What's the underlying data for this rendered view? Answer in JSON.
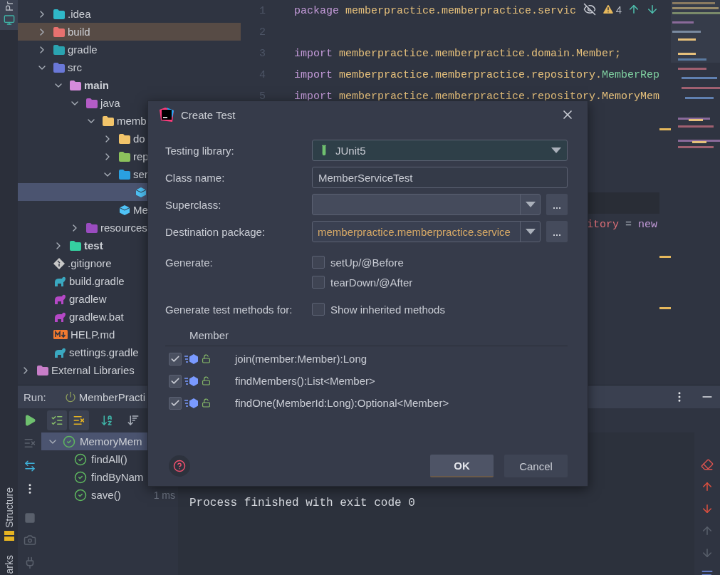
{
  "left_stripe": {
    "top_tools": [
      {
        "label": "Pr",
        "selected": true
      }
    ],
    "bottom_tools": [
      {
        "label": "Structure",
        "selected": false
      },
      {
        "label": "arks",
        "selected": false
      }
    ]
  },
  "project_tree": {
    "root_children": [
      {
        "label": ".idea",
        "kind": "idea-folder",
        "expanded": false,
        "selected": false
      },
      {
        "label": "build",
        "kind": "excluded-folder",
        "expanded": false,
        "selected": false
      },
      {
        "label": "gradle",
        "kind": "gradle-folder",
        "expanded": false,
        "selected": false
      },
      {
        "label": "src",
        "kind": "src-folder",
        "expanded": true,
        "selected": false,
        "children": [
          {
            "label": "main",
            "kind": "source-root",
            "expanded": true,
            "selected": false,
            "children": [
              {
                "label": "java",
                "kind": "java-folder",
                "expanded": true,
                "selected": false,
                "children": [
                  {
                    "label": "memb",
                    "kind": "package",
                    "expanded": true,
                    "selected": false,
                    "children": [
                      {
                        "label": "do",
                        "kind": "package",
                        "expanded": false,
                        "selected": false
                      },
                      {
                        "label": "rep",
                        "kind": "db-package",
                        "expanded": false,
                        "selected": false
                      },
                      {
                        "label": "ser",
                        "kind": "service-package",
                        "expanded": true,
                        "selected": false,
                        "children": [
                          {
                            "kind": "class",
                            "selected": true
                          }
                        ]
                      },
                      {
                        "label": "Me",
                        "kind": "app-class",
                        "selected": false
                      }
                    ]
                  }
                ]
              },
              {
                "label": "resources",
                "kind": "resources-folder",
                "expanded": false,
                "selected": false
              }
            ]
          },
          {
            "label": "test",
            "kind": "test-root",
            "expanded": false,
            "selected": false
          }
        ]
      },
      {
        "label": ".gitignore",
        "kind": "git-file",
        "selected": false
      },
      {
        "label": "build.gradle",
        "kind": "gradle-file",
        "selected": false
      },
      {
        "label": "gradlew",
        "kind": "script-file",
        "selected": false
      },
      {
        "label": "gradlew.bat",
        "kind": "script-file",
        "selected": false
      },
      {
        "label": "HELP.md",
        "kind": "markdown-file",
        "selected": false
      },
      {
        "label": "settings.gradle",
        "kind": "gradle-file",
        "selected": false
      }
    ],
    "siblings": [
      {
        "label": "External Libraries",
        "kind": "library",
        "expanded": false,
        "selected": false
      }
    ]
  },
  "editor": {
    "lines": [
      {
        "number": "1",
        "tokens": [
          {
            "kind": "keyword",
            "text": "package "
          },
          {
            "kind": "path",
            "text": "memberpractice.memberpractice.servic"
          }
        ]
      },
      {
        "number": "2"
      },
      {
        "number": "3",
        "tokens": [
          {
            "kind": "keyword",
            "text": "import "
          },
          {
            "kind": "path",
            "text": "memberpractice.memberpractice.domain.Member;"
          }
        ]
      },
      {
        "number": "4",
        "tokens": [
          {
            "kind": "keyword",
            "text": "import "
          },
          {
            "kind": "path",
            "text": "memberpractice.memberpractice.repository."
          },
          {
            "kind": "type",
            "text": "MemberRep"
          }
        ]
      },
      {
        "number": "5",
        "tokens": [
          {
            "kind": "keyword",
            "text": "import "
          },
          {
            "kind": "path",
            "text": "memberpractice.memberpractice.repository.MemoryMem"
          }
        ]
      }
    ],
    "fragment": {
      "tokens": [
        {
          "kind": "field",
          "text": "itory"
        },
        {
          "kind": "operator",
          "text": " = "
        },
        {
          "kind": "keyword",
          "text": "new"
        }
      ]
    },
    "inspections": {
      "warnings": "4"
    }
  },
  "run_panel": {
    "label": "Run:",
    "tab": "MemberPracti",
    "tests": [
      {
        "label": "MemoryMem",
        "passed": true,
        "expanded": true,
        "selected": true,
        "children": [
          {
            "label": "findAll()",
            "passed": true,
            "selected": false
          },
          {
            "label": "findByNam",
            "passed": true,
            "selected": false
          },
          {
            "label": "save()",
            "passed": true,
            "selected": false,
            "duration": "1 ms"
          }
        ]
      }
    ],
    "console": [
      "Process finished with exit code 0"
    ]
  },
  "dialog": {
    "title": "Create Test",
    "fields": [
      {
        "kind": "combo",
        "label": "Testing library:",
        "value": "JUnit5"
      },
      {
        "kind": "text",
        "label": "Class name:",
        "value": "MemberServiceTest"
      },
      {
        "kind": "browse",
        "label": "Superclass:"
      },
      {
        "kind": "browse",
        "label": "Destination package:",
        "value": "memberpractice.memberpractice.service"
      }
    ],
    "generate": {
      "label": "Generate:",
      "options": [
        {
          "label": "setUp/@Before",
          "checked": false
        },
        {
          "label": "tearDown/@After",
          "checked": false
        }
      ]
    },
    "methods": {
      "label": "Generate test methods for:",
      "option": {
        "label": "Show inherited methods",
        "checked": false
      },
      "header": "Member",
      "rows": [
        {
          "checked": true,
          "signature": "join(member:Member):Long"
        },
        {
          "checked": true,
          "signature": "findMembers():List<Member>"
        },
        {
          "checked": true,
          "signature": "findOne(MemberId:Long):Optional<Member>"
        }
      ]
    },
    "buttons": [
      {
        "label": "OK",
        "default": true
      },
      {
        "label": "Cancel",
        "default": false
      }
    ]
  }
}
